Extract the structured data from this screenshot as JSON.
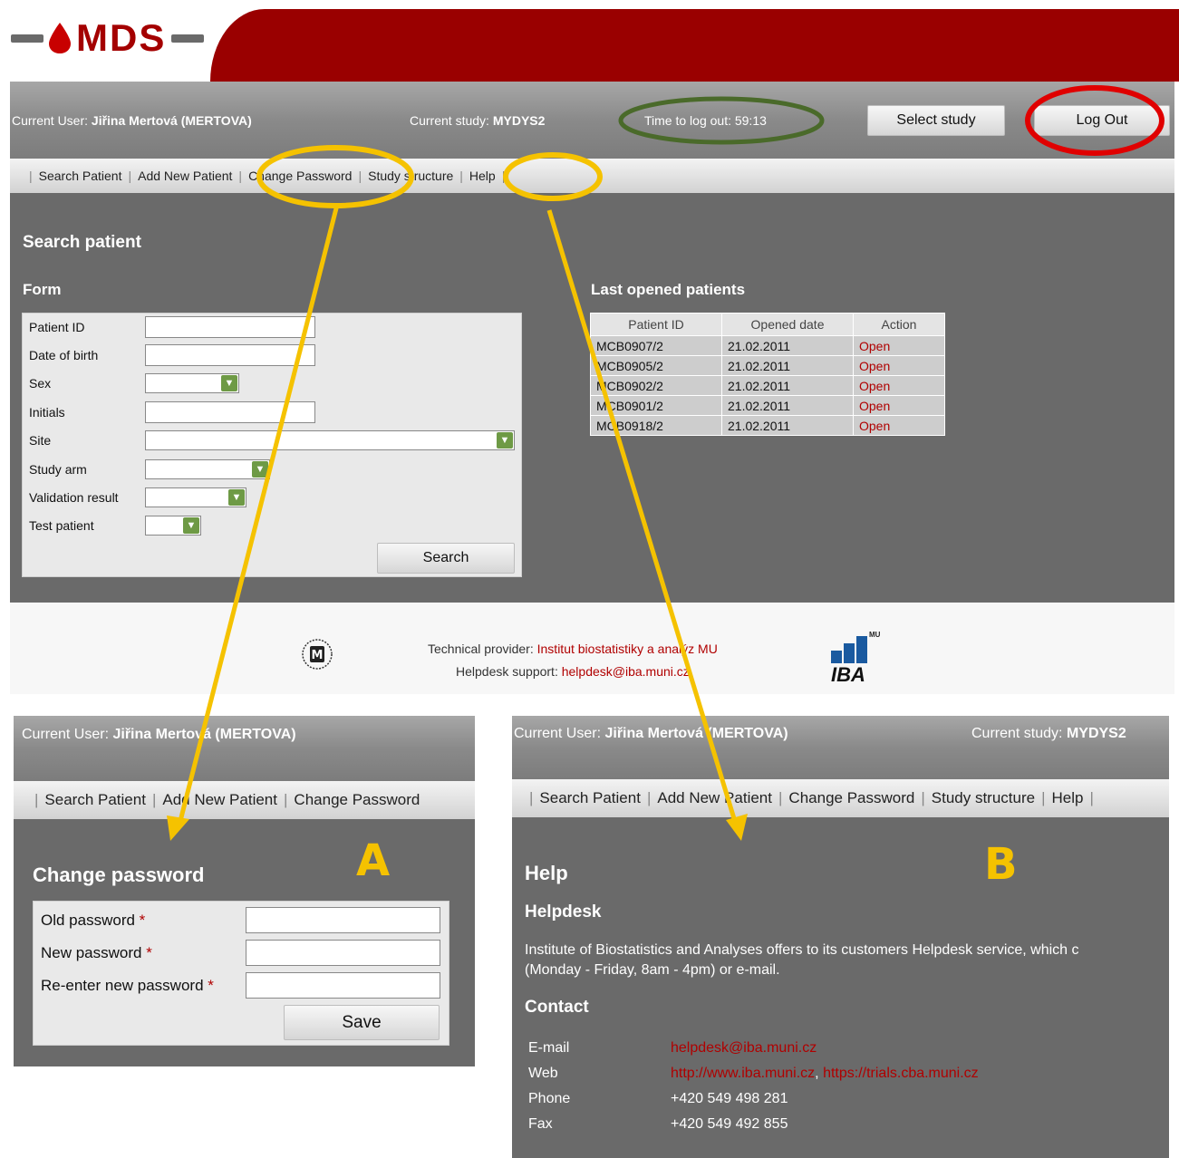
{
  "logo": {
    "text": "MDS"
  },
  "main": {
    "current_user_label": "Current User:",
    "current_user_value": "Jiřina Mertová (MERTOVA)",
    "current_study_label": "Current study:",
    "current_study_value": "MYDYS2",
    "timer_text": "Time to log out: 59:13",
    "select_study_button": "Select study",
    "logout_button": "Log Out",
    "nav": [
      "Search Patient",
      "Add New Patient",
      "Change Password",
      "Study structure",
      "Help"
    ],
    "page_title": "Search patient",
    "form_title": "Form",
    "form_labels": [
      "Patient ID",
      "Date of birth",
      "Sex",
      "Initials",
      "Site",
      "Study arm",
      "Validation result",
      "Test patient"
    ],
    "search_button": "Search",
    "last_opened_title": "Last opened patients",
    "table_headers": [
      "Patient ID",
      "Opened date",
      "Action"
    ],
    "table_rows": [
      [
        "MCB0907/2",
        "21.02.2011",
        "Open"
      ],
      [
        "MCB0905/2",
        "21.02.2011",
        "Open"
      ],
      [
        "MCB0902/2",
        "21.02.2011",
        "Open"
      ],
      [
        "MCB0901/2",
        "21.02.2011",
        "Open"
      ],
      [
        "MCB0918/2",
        "21.02.2011",
        "Open"
      ]
    ]
  },
  "footer": {
    "tech_label": "Technical provider:",
    "tech_value": "Institut biostatistiky a analýz MU",
    "helpdesk_label": "Helpdesk support:",
    "helpdesk_value": "helpdesk@iba.muni.cz",
    "iba_logo_text": "IBA",
    "iba_logo_sup": "MU"
  },
  "panel_a": {
    "label": "A",
    "current_user_label": "Current User:",
    "current_user_value": "Jiřina Mertová (MERTOVA)",
    "nav": [
      "Search Patient",
      "Add New Patient",
      "Change Password"
    ],
    "title": "Change password",
    "fields": [
      "Old password",
      "New password",
      "Re-enter new password"
    ],
    "required_mark": "*",
    "save_button": "Save"
  },
  "panel_b": {
    "label": "B",
    "current_user_label": "Current User:",
    "current_user_value": "Jiřina Mertová (MERTOVA)",
    "current_study_label": "Current study:",
    "current_study_value": "MYDYS2",
    "nav": [
      "Search Patient",
      "Add New Patient",
      "Change Password",
      "Study structure",
      "Help"
    ],
    "title": "Help",
    "subtitle": "Helpdesk",
    "paragraph_line1": "Institute of Biostatistics and Analyses offers to its customers Helpdesk service, which c",
    "paragraph_line2": "(Monday - Friday, 8am - 4pm) or e-mail.",
    "contact_title": "Contact",
    "contact_labels": [
      "E-mail",
      "Web",
      "Phone",
      "Fax"
    ],
    "email": "helpdesk@iba.muni.cz",
    "web1": "http://www.iba.muni.cz",
    "web2": "https://trials.cba.muni.cz",
    "phone": "+420 549 498 281",
    "fax": "+420 549 492 855"
  },
  "colors": {
    "brand_red": "#9a0000",
    "annotation_yellow": "#f5c200",
    "annotation_green": "#4a6a2a",
    "annotation_red": "#e00000",
    "link_red": "#b00000"
  }
}
